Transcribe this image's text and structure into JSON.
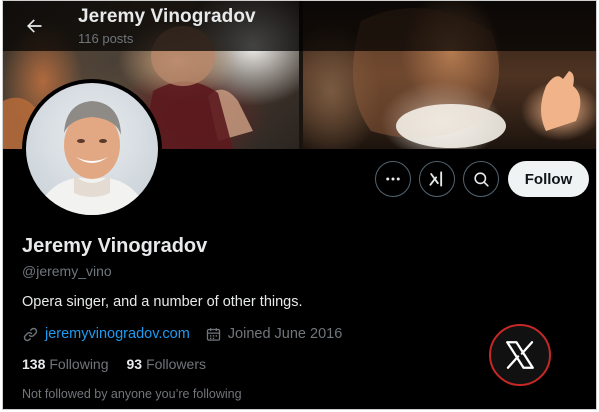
{
  "header": {
    "title": "Jeremy Vinogradov",
    "posts_count": "116 posts"
  },
  "profile": {
    "display_name": "Jeremy Vinogradov",
    "handle": "@jeremy_vino",
    "bio": "Opera singer, and a number of other things.",
    "website": "jeremyvinogradov.com",
    "joined": "Joined June 2016",
    "following_count": "138",
    "following_label": "Following",
    "followers_count": "93",
    "followers_label": "Followers",
    "followed_by": "Not followed by anyone you’re following"
  },
  "actions": {
    "follow_label": "Follow",
    "more_icon": "more-icon",
    "grok_icon": "grok-icon",
    "search_icon": "search-icon"
  },
  "icons": {
    "back": "back-arrow-icon",
    "link": "link-icon",
    "calendar": "calendar-icon",
    "x_logo": "x-logo-icon"
  },
  "colors": {
    "background": "#000000",
    "text_primary": "#e7e9ea",
    "text_secondary": "#71767b",
    "link": "#1d9bf0",
    "follow_button_bg": "#eff3f4",
    "badge_border": "#c62828"
  }
}
